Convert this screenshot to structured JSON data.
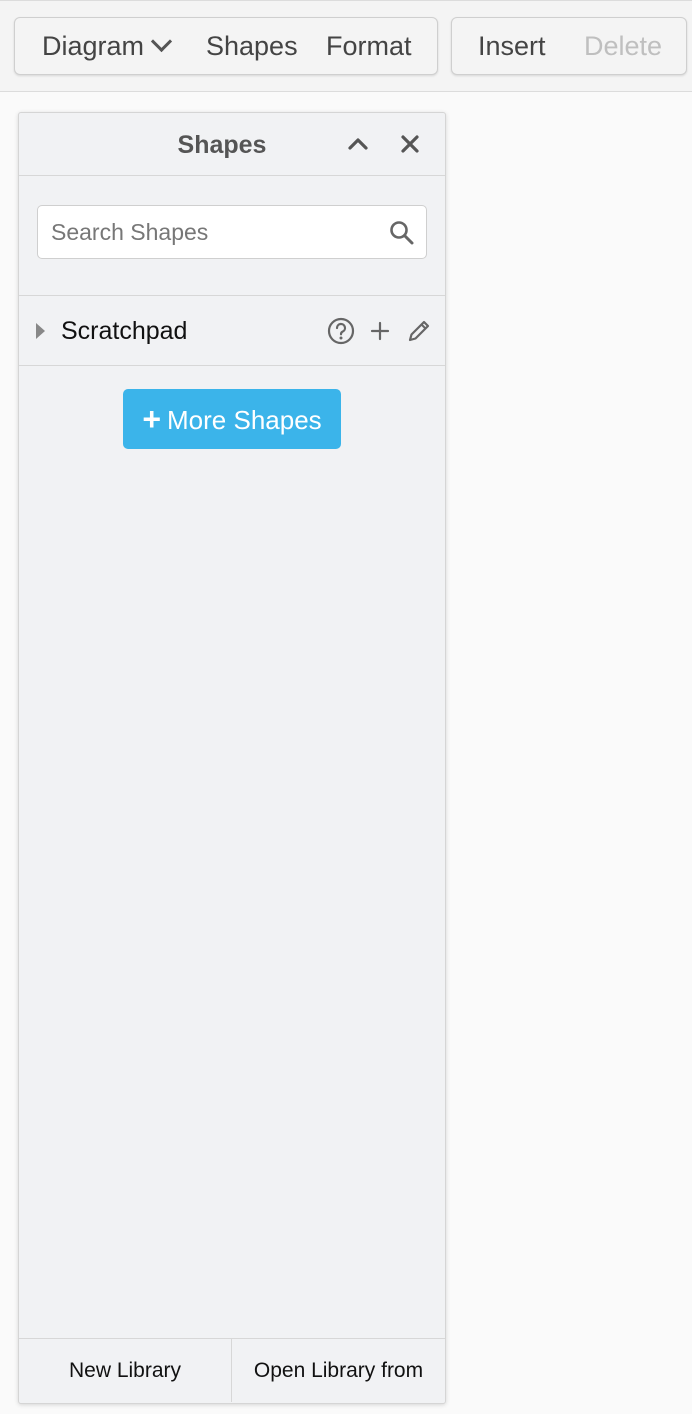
{
  "toolbar": {
    "diagram_label": "Diagram",
    "shapes_label": "Shapes",
    "format_label": "Format",
    "insert_label": "Insert",
    "delete_label": "Delete"
  },
  "panel": {
    "title": "Shapes",
    "search_placeholder": "Search Shapes",
    "scratchpad_label": "Scratchpad",
    "more_shapes_label": "More Shapes",
    "new_library_label": "New Library",
    "open_library_label": "Open Library from"
  },
  "colors": {
    "accent": "#3bb4ea",
    "panel_bg": "#f1f2f4",
    "disabled_text": "#bfbfbf"
  },
  "icons": {
    "diagram_menu": "chevron-down-icon",
    "collapse": "chevron-up-icon",
    "close": "close-icon",
    "search": "search-icon",
    "scratch_expand": "triangle-right-icon",
    "help": "help-circle-icon",
    "add": "plus-icon",
    "edit": "pencil-icon"
  }
}
